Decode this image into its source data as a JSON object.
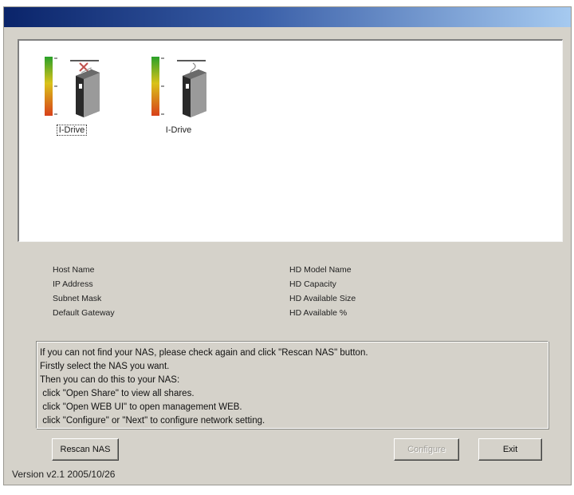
{
  "devices": [
    {
      "label": "I-Drive",
      "status": "disconnected",
      "selected": true
    },
    {
      "label": "I-Drive",
      "status": "connected",
      "selected": false
    }
  ],
  "info": {
    "left_fields": [
      "Host Name",
      "IP Address",
      "Subnet Mask",
      "Default Gateway"
    ],
    "right_fields": [
      "HD Model Name",
      "HD Capacity",
      "HD Available Size",
      "HD Available %"
    ]
  },
  "hint_lines": [
    "If you can not find your NAS, please check again and click \"Rescan NAS\" button.",
    "Firstly select the NAS you want.",
    "Then you can do this to your NAS:",
    " click \"Open Share\" to view all shares.",
    " click \"Open WEB UI\" to open management WEB.",
    " click \"Configure\" or \"Next\" to configure network setting."
  ],
  "buttons": {
    "rescan": "Rescan NAS",
    "configure": "Configure",
    "exit": "Exit"
  },
  "version": "Version v2.1 2005/10/26",
  "colors": {
    "title_gradient_start": "#0a246a",
    "title_gradient_end": "#a6caf0",
    "disconnect_mark": "#c0504d"
  }
}
